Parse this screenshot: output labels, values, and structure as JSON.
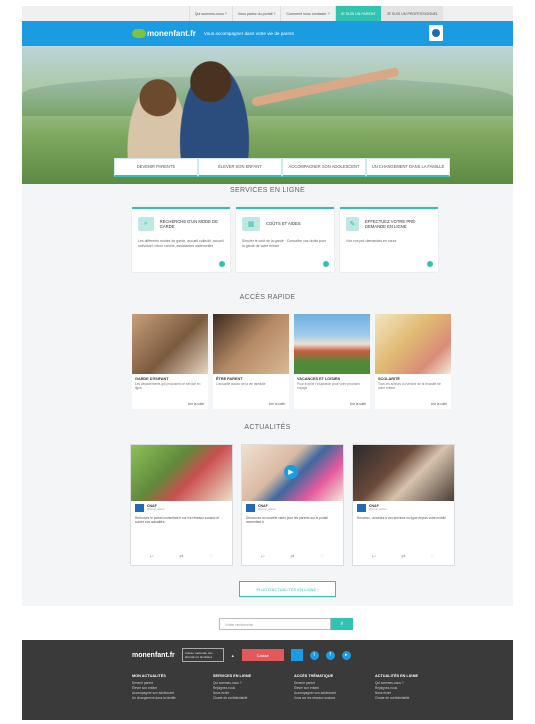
{
  "topbar": {
    "links": [
      "Qui sommes-nous ?",
      "Vous parlez du portail ?",
      "Comment nous contacter ?"
    ],
    "active_tab": "JE SUIS UN PARENT",
    "pro_tab": "JE SUIS UN PROFESSIONNEL"
  },
  "header": {
    "logo": "monenfant.fr",
    "tagline": "Vous accompagner dans votre vie de parent"
  },
  "hero_nav": [
    "DEVENIR PARENTS",
    "ÉLEVER SON ENFANT",
    "ACCOMPAGNER SON ADOLESCENT",
    "UN CHANGEMENT DANS LA FAMILLE"
  ],
  "services": {
    "title": "SERVICES EN LIGNE",
    "cards": [
      {
        "title": "RECHERCHE D'UN MODE DE GARDE",
        "body": "Les différents modes de garde, accueil collectif, accueil individuel, micro crèche, assistantes maternelles"
      },
      {
        "title": "COÛTS ET AIDES",
        "body": "Simuler le coût de la garde · Connaître vos droits pour la garde de votre enfant"
      },
      {
        "title": "EFFECTUEZ VOTRE PRÉ-DEMANDE EN LIGNE",
        "body": "Voir vos pré-demandes en cours"
      }
    ]
  },
  "quick_access": {
    "title": "ACCÈS RAPIDE",
    "cards": [
      {
        "title": "GARDE D'ENFANT",
        "desc": "Les départements qui proposent ce service en ligne",
        "more": "Lire la suite"
      },
      {
        "title": "ÊTRE PARENT",
        "desc": "L'actualité autour de la vie familiale",
        "more": "Lire la suite"
      },
      {
        "title": "VACANCES ET LOISIRS",
        "desc": "Pour trouver l'inspiration pour votre prochain voyage",
        "more": "Lire la suite"
      },
      {
        "title": "SCOLARITÉ",
        "desc": "Tous les acteurs au service de la réussite de votre enfant",
        "more": "Lire la suite"
      }
    ]
  },
  "news": {
    "title": "ACTUALITÉS",
    "cards": [
      {
        "account": "CNAF",
        "handle": "@cnaf_actus",
        "text": "Retrouvez le portail monenfant.fr sur les réseaux sociaux et suivez nos actualités"
      },
      {
        "account": "CNAF",
        "handle": "@cnaf_actus",
        "text": "Découvrez la nouvelle vidéo pour les parents sur le portail monenfant.fr"
      },
      {
        "account": "CNAF",
        "handle": "@cnaf_actus",
        "text": "Nouveau : accédez à vos services en ligne depuis votre mobile"
      }
    ],
    "more": "PLUS D'ACTUALITÉS EN LIGNE"
  },
  "search": {
    "placeholder": "Votre recherche"
  },
  "footer": {
    "logo": "monenfant.fr",
    "partner1": "Caisse nationale des allocations familiales",
    "partner2": "Caisse",
    "columns": [
      {
        "title": "MON ACTUALITÉS",
        "items": [
          "Devenir parent",
          "Élever son enfant",
          "Accompagner son adolescent",
          "Un changement dans la famille"
        ]
      },
      {
        "title": "SERVICES EN LIGNE",
        "items": [
          "Qui sommes-nous ?",
          "Rejoignez-nous",
          "Nous écrire",
          "Charte de confidentialité"
        ]
      },
      {
        "title": "ACCÈS THÉMATIQUE",
        "items": [
          "Devenir parent",
          "Élever son enfant",
          "Accompagner son adolescent",
          "Vous sur les réseaux sociaux"
        ]
      },
      {
        "title": "ACTUALITÉS EN LIGNE",
        "items": [
          "Qui sommes-nous ?",
          "Rejoignez-nous",
          "Nous écrire",
          "Charte de confidentialité"
        ]
      }
    ]
  },
  "colors": {
    "teal": "#2fc3b0",
    "blue": "#1b9be0",
    "footer": "#3a3a3a"
  }
}
